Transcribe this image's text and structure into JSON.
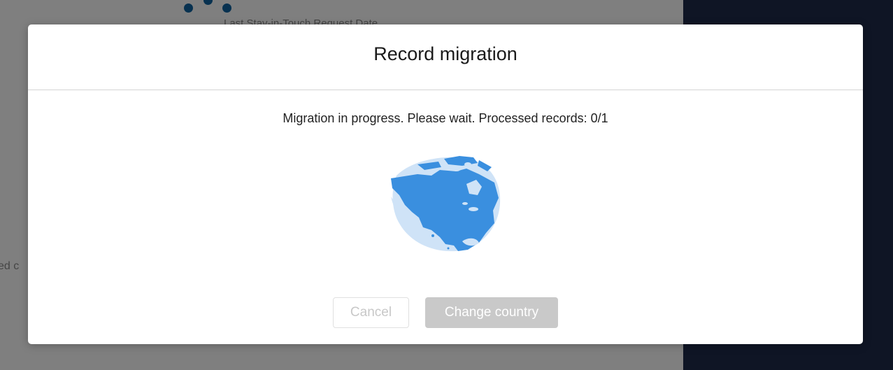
{
  "background": {
    "column_header": "Last Stay-in-Touch Request Date",
    "partial_text": "ed c",
    "sidebar_color": "#1e2a4a"
  },
  "modal": {
    "title": "Record migration",
    "status": "Migration in progress. Please wait. Processed records: 0/1",
    "processed": 0,
    "total": 1,
    "illustration": "globe-north-america-icon",
    "buttons": {
      "cancel": "Cancel",
      "change_country": "Change country"
    }
  },
  "colors": {
    "globe_land": "#3a8fdf",
    "globe_water": "#cfe3f7",
    "button_disabled": "#c9c9c9"
  }
}
